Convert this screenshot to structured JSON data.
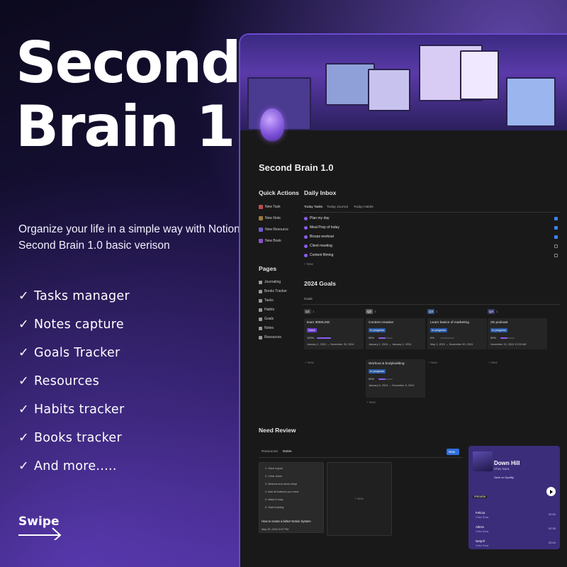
{
  "promo": {
    "title_line1": "Second",
    "title_line2": "Brain 1.0",
    "subtitle": "Organize your life in a simple way with Notion Second Brain 1.0 basic verison",
    "features": [
      "Tasks manager",
      "Notes capture",
      "Goals Tracker",
      "Resources",
      "Habits tracker",
      "Books tracker",
      "And more....."
    ],
    "check": "✓",
    "swipe": "Swipe"
  },
  "app": {
    "page_title": "Second Brain 1.0",
    "quick_actions": {
      "title": "Quick Actions",
      "items": [
        {
          "label": "New Task",
          "color": "#c04b4b"
        },
        {
          "label": "New Note",
          "color": "#9a7a3a"
        },
        {
          "label": "New Resource",
          "color": "#6b5bd6"
        },
        {
          "label": "New Book",
          "color": "#8a4fc9"
        }
      ]
    },
    "pages": {
      "title": "Pages",
      "items": [
        "Journaling",
        "Books Tracker",
        "Tasks",
        "Habits",
        "Goals",
        "Notes",
        "Resources"
      ]
    },
    "daily_inbox": {
      "title": "Daily Inbox",
      "tabs": [
        "Today Tasks",
        "Today Journal",
        "Today Habits"
      ],
      "tasks": [
        {
          "label": "Plan my day",
          "done": true
        },
        {
          "label": "Meal Prep of today",
          "done": true
        },
        {
          "label": "Biceps workout",
          "done": true
        },
        {
          "label": "Client meeting",
          "done": false
        },
        {
          "label": "Content filming",
          "done": false
        }
      ],
      "new": "+ New"
    },
    "goals": {
      "title": "2024 Goals",
      "view": "Goals",
      "quarters": [
        {
          "label": "Q1",
          "count": "1",
          "color": "#3a3a3a"
        },
        {
          "label": "Q2",
          "count": "2",
          "color": "#5a5a5a"
        },
        {
          "label": "Q3",
          "count": "1",
          "color": "#2d4f80"
        },
        {
          "label": "Q4",
          "count": "1",
          "color": "#3a3a6a"
        }
      ],
      "cards": [
        {
          "title": "Earn 3000USD",
          "status": "Done",
          "status_color": "#6d3fcf",
          "pct": "100%",
          "fill": 1.0,
          "dates": "January 1, 2024 → November 30, 2024"
        },
        {
          "title": "Content creation",
          "status": "In progress",
          "status_color": "#2a5aa6",
          "pct": "50%",
          "fill": 0.5,
          "dates": "January 1, 2024 → January 1, 2024"
        },
        {
          "title": "Learn basics of marketing",
          "status": "In progress",
          "status_color": "#2a5aa6",
          "pct": "0%",
          "fill": 0.0,
          "dates": "May 1, 2024 → November 30, 2024"
        },
        {
          "title": "2D podcast",
          "status": "In progress",
          "status_color": "#2a5aa6",
          "pct": "50%",
          "fill": 0.5,
          "dates": "November 22, 2024 12:00 AM"
        },
        {
          "title": "Workout & bodybuilding",
          "status": "In progress",
          "status_color": "#2a5aa6",
          "pct": "50%",
          "fill": 0.5,
          "dates": "January 6, 2024 → December 6, 2024"
        }
      ],
      "new": "+ New"
    },
    "need_review": {
      "title": "Need Review",
      "tabs": [
        "Resources",
        "Notes"
      ],
      "new_button": "New",
      "steps": [
        "1.  Have a goal",
        "2.  Clear vision",
        "3.  Minimal and clean setup",
        "4.  Add all features you need",
        "5.  Make it easy",
        "6.  Start building"
      ],
      "card_title": "How to create a better Notion System",
      "card_date": "May 25, 2024 3:57 PM",
      "new": "+ New"
    },
    "spotify": {
      "title": "Down Hill",
      "artist": "Chez Sura",
      "save": "Save on Spotify",
      "badge": "PREVIEW",
      "tracks": [
        {
          "name": "Felicia",
          "artist": "Chez Sura",
          "dur": "02:52"
        },
        {
          "name": "Altera",
          "artist": "Chez Sura",
          "dur": "02:35"
        },
        {
          "name": "Netyrh",
          "artist": "Chez Sura",
          "dur": "02:04"
        }
      ]
    }
  }
}
